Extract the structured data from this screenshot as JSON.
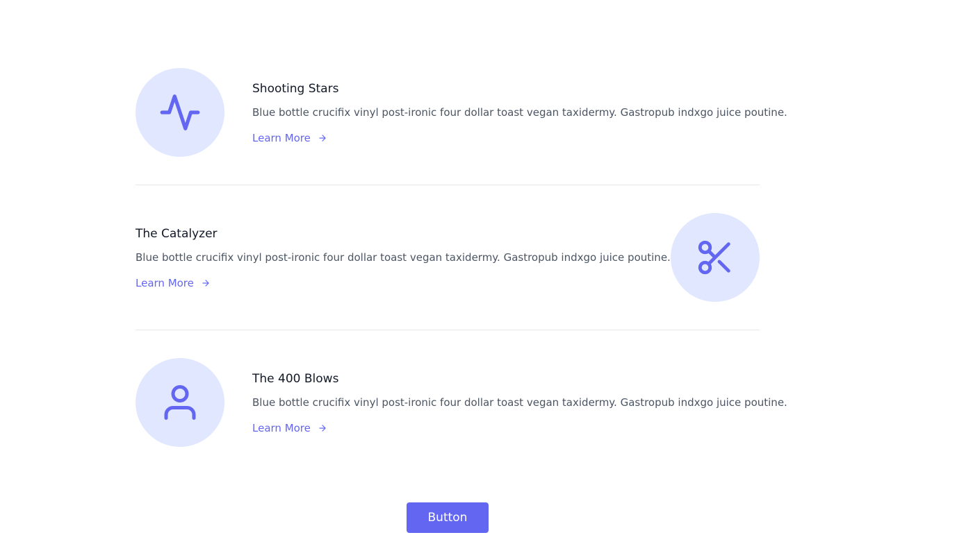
{
  "features": [
    {
      "title": "Shooting Stars",
      "description": "Blue bottle crucifix vinyl post-ironic four dollar toast vegan taxidermy. Gastropub indxgo juice poutine.",
      "link_label": "Learn More",
      "icon": "activity-icon"
    },
    {
      "title": "The Catalyzer",
      "description": "Blue bottle crucifix vinyl post-ironic four dollar toast vegan taxidermy. Gastropub indxgo juice poutine.",
      "link_label": "Learn More",
      "icon": "scissors-icon"
    },
    {
      "title": "The 400 Blows",
      "description": "Blue bottle crucifix vinyl post-ironic four dollar toast vegan taxidermy. Gastropub indxgo juice poutine.",
      "link_label": "Learn More",
      "icon": "user-icon"
    }
  ],
  "button_label": "Button",
  "colors": {
    "accent": "#6366f1",
    "icon_bg": "#e0e7ff",
    "title": "#111827",
    "body": "#4b5563",
    "divider": "#e5e7eb"
  }
}
